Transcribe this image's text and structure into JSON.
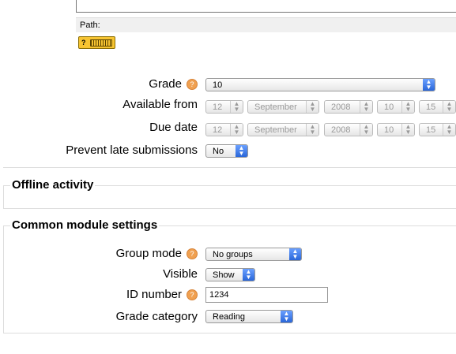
{
  "editor": {
    "path_label": "Path:"
  },
  "grade_section": {
    "grade": {
      "label": "Grade",
      "value": "10"
    },
    "available_from": {
      "label": "Available from",
      "day": "12",
      "month": "September",
      "year": "2008",
      "hour": "10",
      "minute": "15"
    },
    "due_date": {
      "label": "Due date",
      "day": "12",
      "month": "September",
      "year": "2008",
      "hour": "10",
      "minute": "15"
    },
    "prevent_late": {
      "label": "Prevent late submissions",
      "value": "No"
    }
  },
  "offline_activity": {
    "legend": "Offline activity"
  },
  "common_module": {
    "legend": "Common module settings",
    "group_mode": {
      "label": "Group mode",
      "value": "No groups"
    },
    "visible": {
      "label": "Visible",
      "value": "Show"
    },
    "id_number": {
      "label": "ID number",
      "value": "1234"
    },
    "grade_category": {
      "label": "Grade category",
      "value": "Reading"
    }
  },
  "colors": {
    "select_arrow": "#2a66d8",
    "help_icon": "#f0a050",
    "keyboard_help": "#f7c431"
  }
}
